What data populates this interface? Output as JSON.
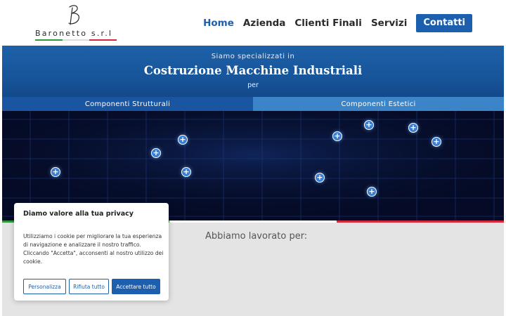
{
  "header": {
    "logo": {
      "text": "Baronetto  s.r.l",
      "mark": "B"
    },
    "nav": [
      {
        "label": "Home",
        "active": true
      },
      {
        "label": "Azienda",
        "active": false
      },
      {
        "label": "Clienti Finali",
        "active": false
      },
      {
        "label": "Servizi",
        "active": false
      }
    ],
    "cta_label": "Contatti"
  },
  "hero": {
    "pre_title": "Siamo specializzati in",
    "title": "Costruzione Macchine Industriali",
    "post_title": "per"
  },
  "tabs": [
    {
      "label": "Componenti Strutturali"
    },
    {
      "label": "Componenti Estetici"
    }
  ],
  "hotspot_icon": "plus-icon",
  "hotspot_glyph": "+",
  "section": {
    "title": "Abbiamo lavorato per:"
  },
  "cookie": {
    "title": "Diamo valore alla tua privacy",
    "text": "Utilizziamo i cookie per migliorare la tua esperienza di navigazione e analizzare il nostro traffico. Cliccando \"Accetta\", acconsenti al nostro utilizzo dei cookie.",
    "buttons": {
      "customize": "Personalizza",
      "reject": "Rifiuta tutto",
      "accept": "Accettare tutto"
    }
  },
  "colors": {
    "brand_blue": "#1c5fae",
    "flag_green": "#2e9a3e",
    "flag_white": "#ffffff",
    "flag_red": "#d6283a"
  }
}
